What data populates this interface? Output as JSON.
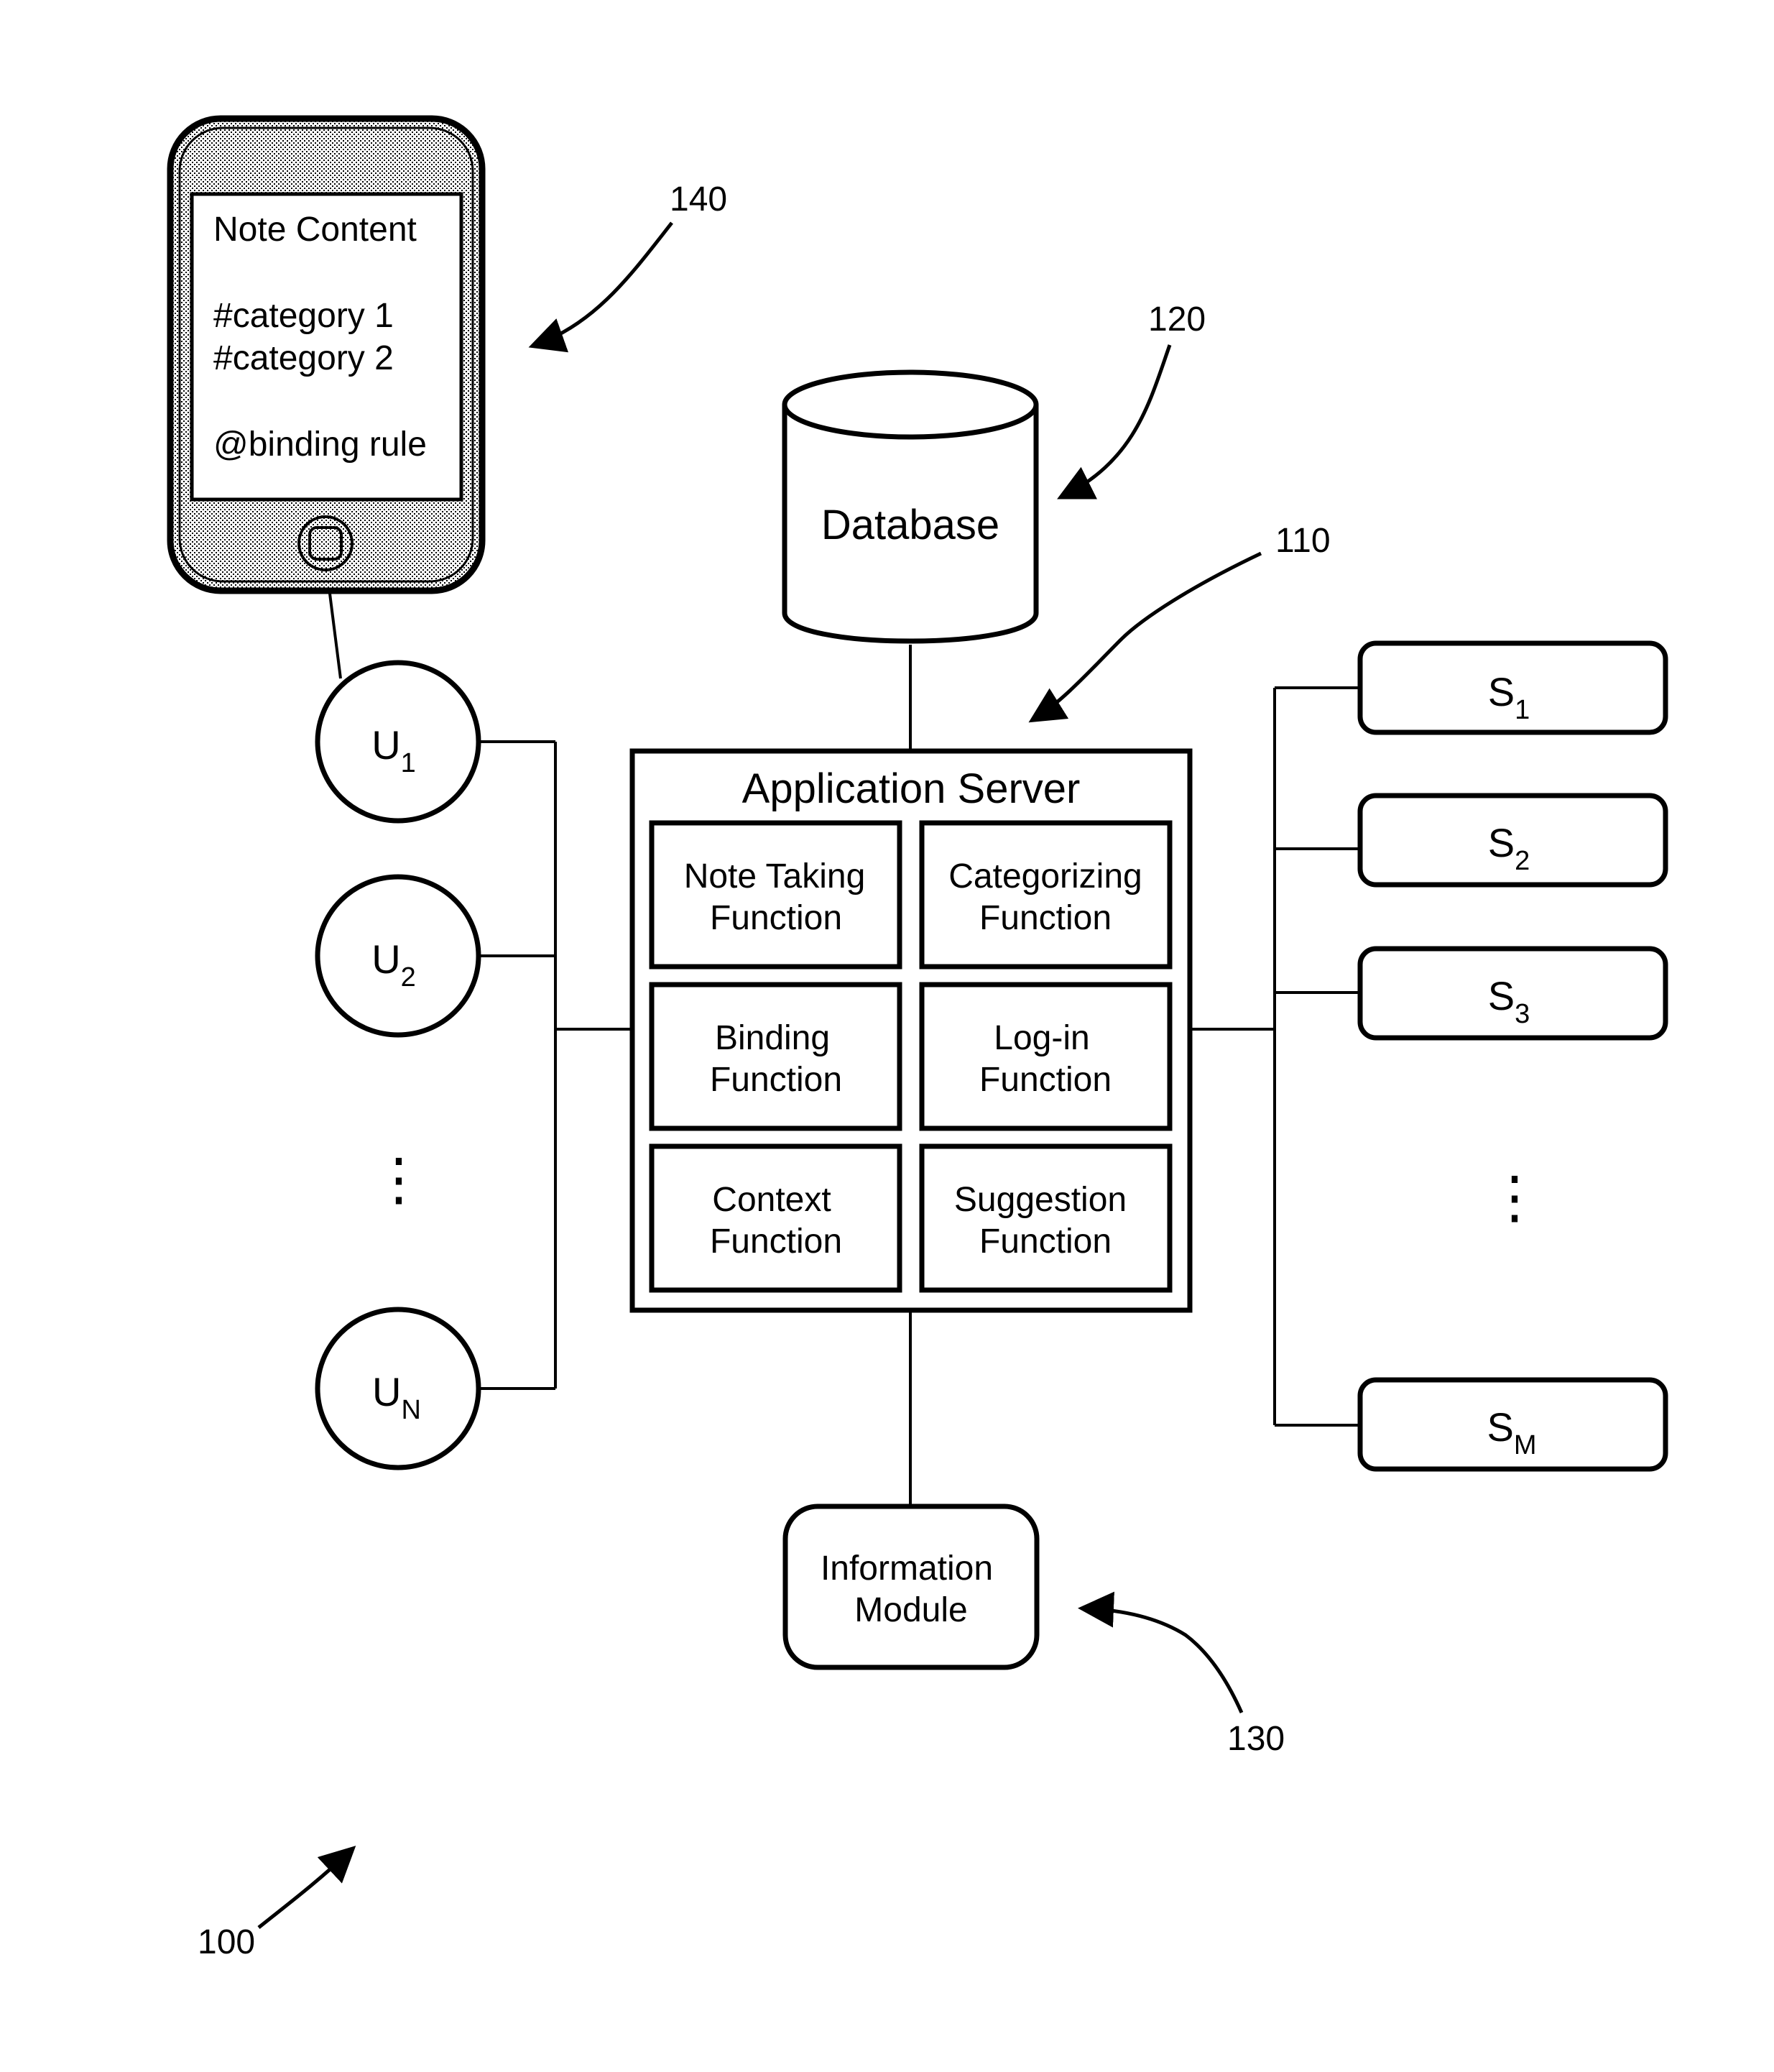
{
  "figure_ref": "100",
  "device": {
    "ref": "140",
    "screen_lines": [
      "Note Content",
      "#category 1",
      "#category 2",
      "@binding rule"
    ]
  },
  "database": {
    "ref": "120",
    "label": "Database"
  },
  "application_server": {
    "ref": "110",
    "title": "Application Server",
    "functions": [
      {
        "line1": "Note Taking",
        "line2": "Function"
      },
      {
        "line1": "Categorizing",
        "line2": "Function"
      },
      {
        "line1": "Binding",
        "line2": "Function"
      },
      {
        "line1": "Log-in",
        "line2": "Function"
      },
      {
        "line1": "Context",
        "line2": "Function"
      },
      {
        "line1": "Suggestion",
        "line2": "Function"
      }
    ]
  },
  "information_module": {
    "ref": "130",
    "line1": "Information",
    "line2": "Module"
  },
  "users": [
    {
      "base": "U",
      "sub": "1"
    },
    {
      "base": "U",
      "sub": "2"
    },
    {
      "base": "U",
      "sub": "N"
    }
  ],
  "users_ellipsis": "⋮",
  "services": [
    {
      "base": "S",
      "sub": "1"
    },
    {
      "base": "S",
      "sub": "2"
    },
    {
      "base": "S",
      "sub": "3"
    },
    {
      "base": "S",
      "sub": "M"
    }
  ],
  "services_ellipsis": "⋮"
}
